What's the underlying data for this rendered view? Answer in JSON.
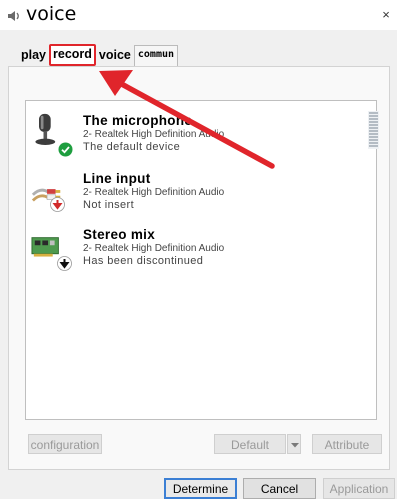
{
  "window": {
    "title": "voice",
    "close_glyph": "×"
  },
  "tabs": [
    {
      "label": "play",
      "selected": false
    },
    {
      "label": "record",
      "selected": true
    },
    {
      "label": "voice",
      "selected": false
    },
    {
      "label": "commun",
      "selected": false
    }
  ],
  "devices": [
    {
      "name": "The microphone",
      "driver": "2- Realtek High Definition Audio",
      "status": "The default device",
      "icon": "microphone-icon",
      "badge": "default-check-badge"
    },
    {
      "name": "Line input",
      "driver": "2- Realtek High Definition Audio",
      "status": "Not insert",
      "icon": "line-input-cable-icon",
      "badge": "unplugged-badge"
    },
    {
      "name": "Stereo mix",
      "driver": "2- Realtek High Definition Audio",
      "status": "Has been discontinued",
      "icon": "sound-card-icon",
      "badge": "disabled-badge"
    }
  ],
  "panel_buttons": {
    "configuration": "configuration",
    "default": "Default",
    "attribute": "Attribute"
  },
  "dialog_buttons": {
    "determine": "Determine",
    "cancel": "Cancel",
    "application": "Application"
  },
  "colors": {
    "annotation": "#e0252b",
    "check_badge": "#1e9e3f",
    "focus": "#3b7fd4"
  }
}
